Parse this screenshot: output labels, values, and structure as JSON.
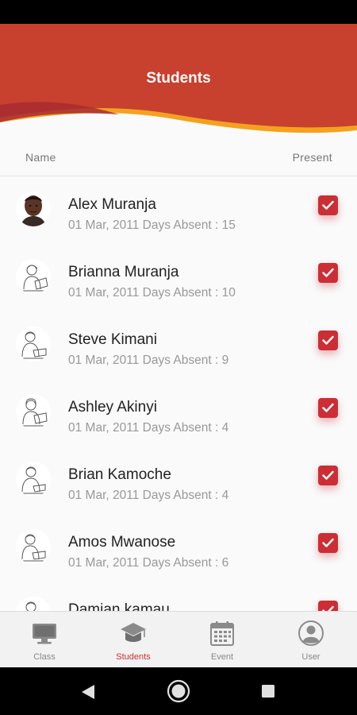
{
  "header": {
    "title": "Students"
  },
  "columns": {
    "name": "Name",
    "present": "Present"
  },
  "students": [
    {
      "name": "Alex Muranja",
      "subtitle": "01 Mar, 2011 Days Absent : 15",
      "present": true,
      "avatar": "photo"
    },
    {
      "name": "Brianna Muranja",
      "subtitle": "01 Mar, 2011 Days Absent : 10",
      "present": true,
      "avatar": "sketch"
    },
    {
      "name": "Steve Kimani",
      "subtitle": "01 Mar, 2011 Days Absent : 9",
      "present": true,
      "avatar": "sketch"
    },
    {
      "name": "Ashley Akinyi",
      "subtitle": "01 Mar, 2011 Days Absent : 4",
      "present": true,
      "avatar": "sketch"
    },
    {
      "name": "Brian Kamoche",
      "subtitle": "01 Mar, 2011 Days Absent : 4",
      "present": true,
      "avatar": "sketch"
    },
    {
      "name": "Amos Mwanose",
      "subtitle": "01 Mar, 2011 Days Absent : 6",
      "present": true,
      "avatar": "sketch"
    },
    {
      "name": "Damian kamau",
      "subtitle": "",
      "present": true,
      "avatar": "sketch"
    }
  ],
  "bottom_nav": [
    {
      "label": "Class",
      "icon": "monitor-icon",
      "active": false
    },
    {
      "label": "Students",
      "icon": "graduation-cap-icon",
      "active": true
    },
    {
      "label": "Event",
      "icon": "calendar-icon",
      "active": false
    },
    {
      "label": "User",
      "icon": "user-icon",
      "active": false
    }
  ],
  "colors": {
    "accent": "#cc2e35",
    "header_red": "#c8402e",
    "header_orange": "#f0a01e",
    "inactive": "#888888"
  }
}
